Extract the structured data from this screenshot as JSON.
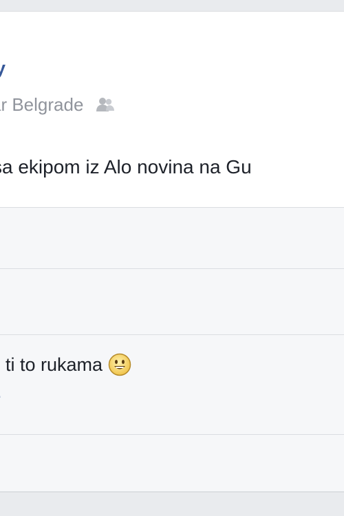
{
  "post": {
    "author_name_fragment": "y",
    "location_fragment": "ar Belgrade",
    "privacy_icon": "friends-icon",
    "text_fragment": "sa ekipom iz Alo novina na Gu"
  },
  "comment": {
    "text_fragment": "ti to rukama",
    "emoji_icon": "smile-emoji-icon",
    "link_fragment": "e"
  },
  "colors": {
    "background": "#e9ebee",
    "card": "#ffffff",
    "link_blue": "#365899",
    "meta_gray": "#90949c",
    "text": "#1d2129",
    "row_gray": "#f6f7f9"
  }
}
